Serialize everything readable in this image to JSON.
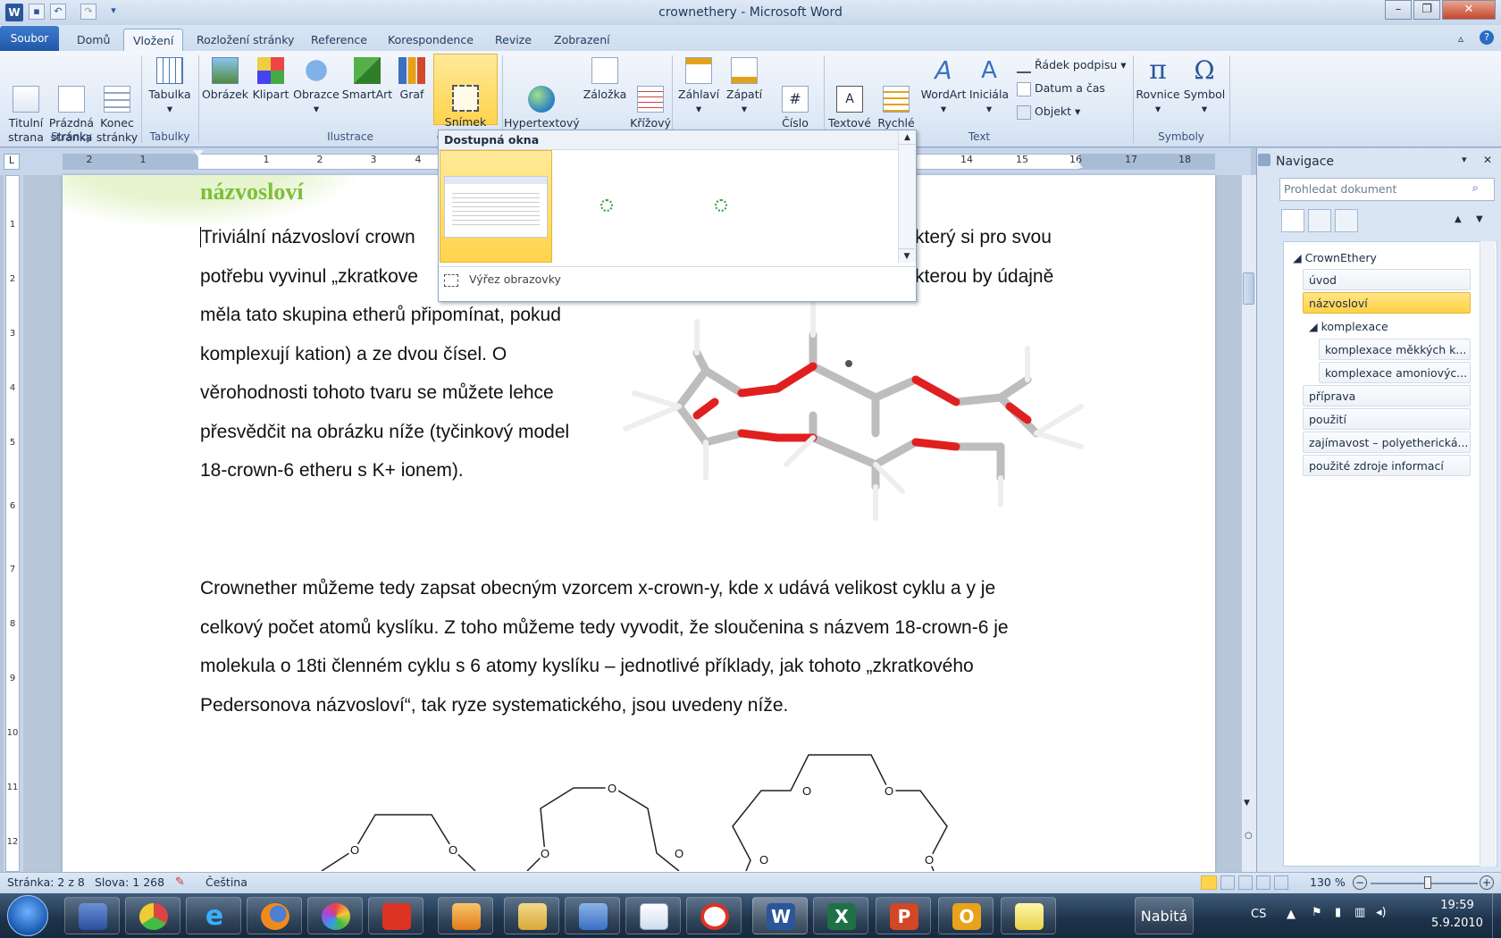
{
  "window": {
    "title": "crownethery - Microsoft Word",
    "app_icon": "W"
  },
  "qat": {
    "save": "▪",
    "undo": "↶",
    "redo": "↷",
    "customize": "▾"
  },
  "tabs": [
    "Soubor",
    "Domů",
    "Vložení",
    "Rozložení stránky",
    "Reference",
    "Korespondence",
    "Revize",
    "Zobrazení"
  ],
  "ribbon": {
    "stranky": {
      "label": "Stránky",
      "titulni": "Titulní\nstrana",
      "prazdna": "Prázdná\nstránka",
      "konec": "Konec\nstránky"
    },
    "tabulky": {
      "label": "Tabulky",
      "tabulka": "Tabulka"
    },
    "ilustrace": {
      "label": "Ilustrace",
      "obrazek": "Obrázek",
      "klipart": "Klipart",
      "obrazce": "Obrazce",
      "smartart": "SmartArt",
      "graf": "Graf",
      "snimek": "Snímek\nobrazovky"
    },
    "odkazy": {
      "hypertext": "Hypertextový\nodkaz",
      "zalozka": "Záložka",
      "krizovy": "Křížový\nodkaz"
    },
    "zahlavi": {
      "zahlavi": "Záhlaví",
      "zapati": "Zápatí",
      "cislo": "Číslo\nstránky"
    },
    "text": {
      "label": "Text",
      "textove": "Textové\npole",
      "rychle": "Rychlé\nčásti",
      "wordart": "WordArt",
      "inicala": "Iniciála",
      "radek": "Řádek podpisu",
      "datum": "Datum a čas",
      "objekt": "Objekt"
    },
    "symboly": {
      "label": "Symboly",
      "rovnice": "Rovnice",
      "symbol": "Symbol"
    }
  },
  "ruler": {
    "numbers": [
      "2",
      "1",
      "1",
      "2",
      "3",
      "4",
      "14",
      "15",
      "16",
      "17",
      "18"
    ]
  },
  "vruler": {
    "numbers": [
      "1",
      "2",
      "3",
      "4",
      "5",
      "6",
      "7",
      "8",
      "9",
      "10",
      "11",
      "12"
    ]
  },
  "dropdown": {
    "header": "Dostupná okna",
    "footer": "Výřez obrazovky"
  },
  "document": {
    "heading": "názvosloví",
    "para1_left": [
      "Triviální názvosloví crown",
      "potřebu vyvinul „zkratkove",
      "měla tato skupina etherů připomínat, pokud",
      "komplexují kation) a ze dvou čísel. O",
      "věrohodnosti tohoto tvaru se můžete lehce",
      "přesvědčit na obrázku níže (tyčinkový model",
      "18-crown-6 etheru s K+ ionem)."
    ],
    "para1_right": [
      "který si pro svou",
      "kterou by údajně"
    ],
    "para2_lines": [
      "Crownether můžeme tedy zapsat obecným vzorcem x-crown-y, kde x udává velikost cyklu a y je",
      "celkový počet atomů kyslíku. Z toho můžeme tedy vyvodit, že sloučenina s názvem 18-crown-6 je",
      "molekula o 18ti členném cyklu s 6 atomy kyslíku – jednotlivé příklady, jak tohoto „zkratkového",
      "Pedersonova názvosloví“, tak ryze systematického, jsou uvedeny níže."
    ],
    "oxygen_label": "O"
  },
  "nav": {
    "title": "Navigace",
    "search_placeholder": "Prohledat dokument",
    "items": [
      {
        "label": "CrownEthery",
        "level": 0
      },
      {
        "label": "úvod",
        "level": 1
      },
      {
        "label": "názvosloví",
        "level": 1,
        "selected": true
      },
      {
        "label": "komplexace",
        "level": 1
      },
      {
        "label": "komplexace měkkých k...",
        "level": 2
      },
      {
        "label": "komplexace amoniovýc...",
        "level": 2
      },
      {
        "label": "příprava",
        "level": 1
      },
      {
        "label": "použití",
        "level": 1
      },
      {
        "label": "zajímavost – polyetherická...",
        "level": 1
      },
      {
        "label": "použité zdroje informací",
        "level": 1
      }
    ]
  },
  "status": {
    "page": "Stránka: 2 z 8",
    "words": "Slova: 1 268",
    "language": "Čeština",
    "zoom": "130 %"
  },
  "taskbar": {
    "battery": "Nabitá",
    "lang": "CS",
    "time": "19:59",
    "date": "5.9.2010"
  },
  "colors": {
    "accent_blue": "#2b579a",
    "heading_green": "#7bbf3a",
    "selection_yellow": "#ffd44c",
    "oxygen_red": "#e02020"
  }
}
